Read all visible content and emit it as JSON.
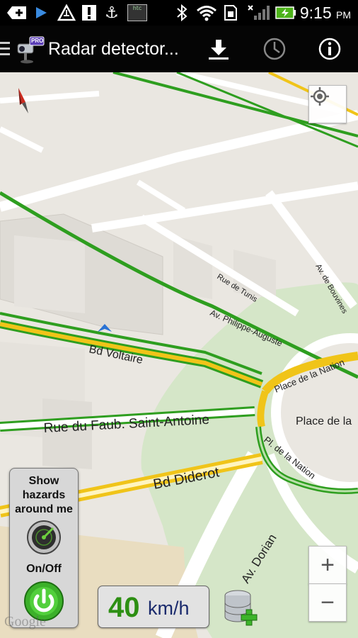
{
  "status_bar": {
    "time": "9:15",
    "ampm": "PM",
    "icons": [
      "add-notification-icon",
      "play-icon",
      "alert-triangle-icon",
      "warning-icon",
      "usb-icon",
      "htc-sync-icon",
      "bluetooth-icon",
      "wifi-icon",
      "sim-icon",
      "signal-icon",
      "battery-charging-icon"
    ],
    "htc_label": "htc"
  },
  "action_bar": {
    "title": "Radar detector...",
    "badge": "PRO",
    "actions": [
      "download-icon",
      "history-clock-icon",
      "info-icon"
    ]
  },
  "map": {
    "streets": [
      "Bd Voltaire",
      "Rue du Faub. Saint-Antoine",
      "Bd Diderot",
      "Av. Dorian",
      "Av. Philippe-Auguste",
      "Rue de Tunis",
      "Av. de Bouvines",
      "Place de la Nation",
      "Pl. de la Nation",
      "Place de la"
    ],
    "attribution": "Google",
    "colors": {
      "green_road": "#2e9e1f",
      "yellow_road": "#f0c419",
      "park": "#d5e6c8",
      "base": "#eae7e1",
      "road": "#ffffff"
    }
  },
  "controls": {
    "zoom_in": "+",
    "zoom_out": "−",
    "hazard_panel": {
      "line1": "Show",
      "line2": "hazards",
      "line3": "around me",
      "toggle_label": "On/Off"
    },
    "speed": {
      "value": "40",
      "unit": "km/h"
    }
  }
}
